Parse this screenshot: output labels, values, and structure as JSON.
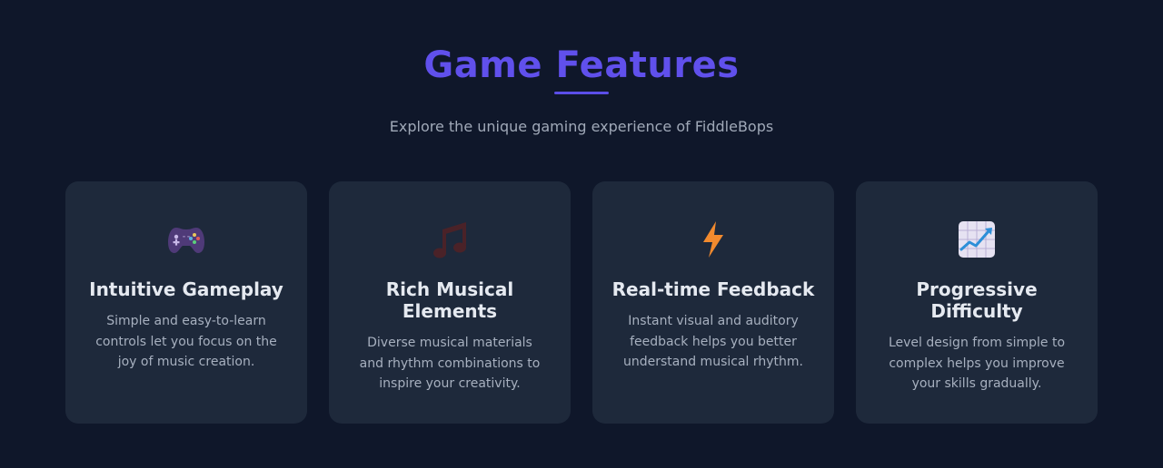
{
  "header": {
    "title": "Game Features",
    "subtitle": "Explore the unique gaming experience of FiddleBops"
  },
  "features": [
    {
      "icon": "game-controller-icon",
      "title": "Intuitive Gameplay",
      "description": "Simple and easy-to-learn controls let you focus on the joy of music creation."
    },
    {
      "icon": "musical-notes-icon",
      "title": "Rich Musical Elements",
      "description": "Diverse musical materials and rhythm combinations to inspire your creativity."
    },
    {
      "icon": "lightning-bolt-icon",
      "title": "Real-time Feedback",
      "description": "Instant visual and auditory feedback helps you better understand musical rhythm."
    },
    {
      "icon": "chart-increasing-icon",
      "title": "Progressive Difficulty",
      "description": "Level design from simple to complex helps you improve your skills gradually."
    }
  ],
  "colors": {
    "background": "#0f172a",
    "card": "#1e293b",
    "accent": "#6050ec"
  }
}
